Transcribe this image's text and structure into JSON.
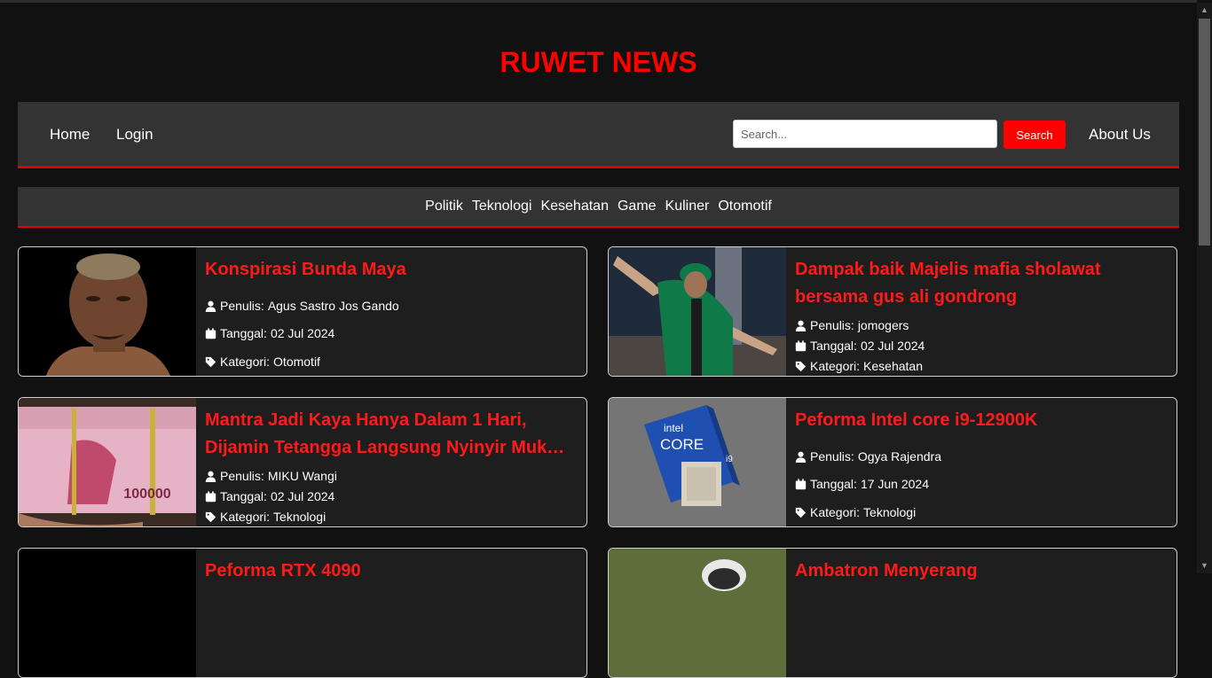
{
  "site_title": "RUWET NEWS",
  "nav": {
    "home": "Home",
    "login": "Login",
    "search_placeholder": "Search...",
    "search_button": "Search",
    "about": "About Us"
  },
  "categories": [
    "Politik",
    "Teknologi",
    "Kesehatan",
    "Game",
    "Kuliner",
    "Otomotif"
  ],
  "meta_labels": {
    "author": "Penulis:",
    "date": "Tanggal:",
    "category": "Kategori:"
  },
  "articles": [
    {
      "title": "Konspirasi Bunda Maya",
      "author": "Agus Sastro Jos Gando",
      "date": "02 Jul 2024",
      "category": "Otomotif"
    },
    {
      "title": "Dampak baik Majelis mafia sholawat bersama gus ali gondrong",
      "author": "jomogers",
      "date": "02 Jul 2024",
      "category": "Kesehatan"
    },
    {
      "title": "Mantra Jadi Kaya Hanya Dalam 1 Hari, Dijamin Tetangga Langsung Nyinyir Muka Masam",
      "author": "MIKU Wangi",
      "date": "02 Jul 2024",
      "category": "Teknologi"
    },
    {
      "title": "Peforma Intel core i9-12900K",
      "author": "Ogya Rajendra",
      "date": "17 Jun 2024",
      "category": "Teknologi"
    },
    {
      "title": "Peforma RTX 4090",
      "author": "",
      "date": "",
      "category": ""
    },
    {
      "title": "Ambatron Menyerang",
      "author": "",
      "date": "",
      "category": ""
    }
  ],
  "thumb_text": {
    "intel": "intel",
    "core": "CORE",
    "i9": "i9",
    "money": "100000"
  },
  "colors": {
    "accent": "#ff0000",
    "background": "#111112",
    "bar": "#333333",
    "card": "#1e1e1e"
  }
}
